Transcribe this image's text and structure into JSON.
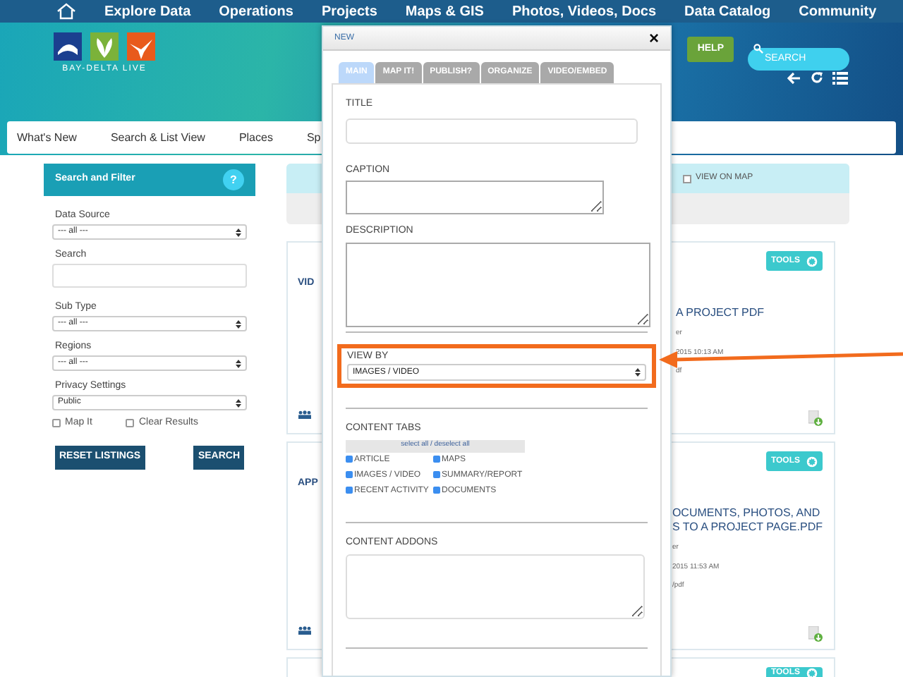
{
  "top_nav": [
    "Explore Data",
    "Operations",
    "Projects",
    "Maps & GIS",
    "Photos, Videos, Docs",
    "Data Catalog",
    "Community"
  ],
  "logo": {
    "text": "BAY-DELTA LIVE"
  },
  "header": {
    "help": "HELP",
    "search_placeholder": "SEARCH"
  },
  "sub_nav": [
    "What's New",
    "Search & List View",
    "Places",
    "Sp"
  ],
  "sidebar": {
    "title": "Search and Filter",
    "help": "?",
    "fields": [
      {
        "kind": "select",
        "label": "Data Source",
        "value": "--- all ---"
      },
      {
        "kind": "text",
        "label": "Search"
      },
      {
        "kind": "select",
        "label": "Sub Type",
        "value": "--- all ---"
      },
      {
        "kind": "select",
        "label": "Regions",
        "value": "--- all ---"
      },
      {
        "kind": "select",
        "label": "Privacy Settings",
        "value": "Public"
      }
    ],
    "checks": [
      {
        "label": "Map It",
        "checked": false
      },
      {
        "label": "Clear Results",
        "checked": false
      }
    ],
    "buttons": [
      "RESET LISTINGS",
      "SEARCH"
    ]
  },
  "results": {
    "view_on_map": {
      "label": "VIEW ON MAP",
      "checked": false
    },
    "cards": [
      {
        "title": "VID",
        "tools": "TOOLS",
        "lines": [
          "A PROJECT PDF",
          "er",
          "2015 10:13 AM",
          "df"
        ]
      },
      {
        "title": "APP",
        "tools": "TOOLS",
        "lines": [
          "OCUMENTS, PHOTOS, AND",
          "S TO A PROJECT PAGE.PDF",
          "er",
          "2015 11:53 AM",
          "/pdf"
        ]
      },
      {
        "tools": "TOOLS"
      }
    ]
  },
  "modal": {
    "title": "NEW",
    "close": "×",
    "tabs": [
      {
        "label": "MAIN",
        "selected": true
      },
      {
        "label": "MAP IT!",
        "selected": false
      },
      {
        "label": "PUBLISH?",
        "selected": false
      },
      {
        "label": "ORGANIZE",
        "selected": false
      },
      {
        "label": "VIDEO/EMBED",
        "selected": false
      }
    ],
    "title_label": "TITLE",
    "caption_label": "CAPTION",
    "description_label": "DESCRIPTION",
    "view_by": {
      "label": "VIEW BY",
      "value": "IMAGES / VIDEO"
    },
    "content_tabs": {
      "label": "CONTENT TABS",
      "select_all": "select all / deselect all",
      "items": [
        {
          "label": "ARTICLE",
          "checked": true
        },
        {
          "label": "MAPS",
          "checked": true
        },
        {
          "label": "IMAGES / VIDEO",
          "checked": true
        },
        {
          "label": "SUMMARY/REPORT",
          "checked": true
        },
        {
          "label": "RECENT ACTIVITY",
          "checked": true
        },
        {
          "label": "DOCUMENTS",
          "checked": true
        }
      ]
    },
    "addons_label": "CONTENT ADDONS"
  }
}
